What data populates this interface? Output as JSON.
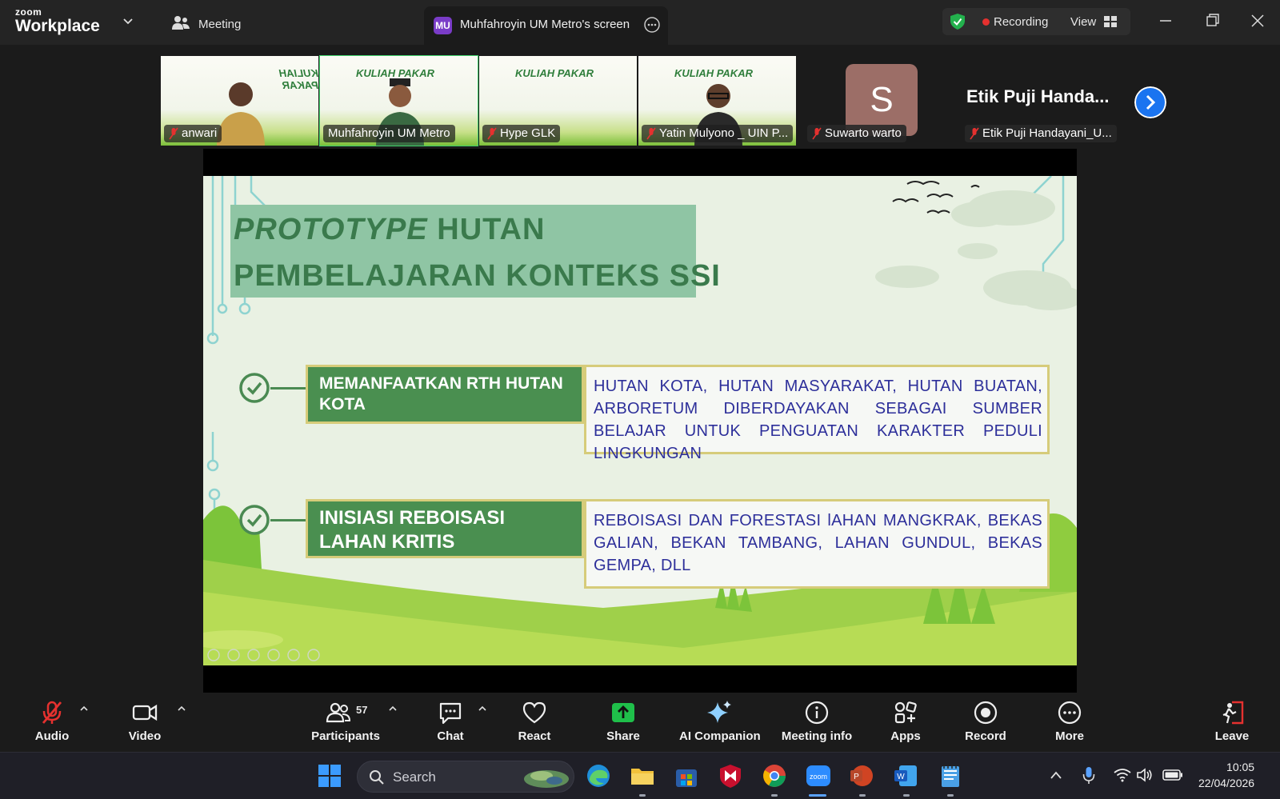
{
  "app": {
    "logo_line1": "zoom",
    "logo_line2": "Workplace",
    "meeting_label": "Meeting",
    "share_tab": {
      "badge": "MU",
      "label": "Muhfahroyin UM Metro's screen"
    },
    "recording_label": "Recording",
    "view_label": "View"
  },
  "participants": [
    {
      "name": "anwari",
      "muted": true
    },
    {
      "name": "Muhfahroyin UM Metro",
      "muted": false,
      "active": true
    },
    {
      "name": "Hype GLK",
      "muted": true
    },
    {
      "name": "Yatin Mulyono _ UIN P...",
      "muted": true
    },
    {
      "name": "Suwarto warto",
      "muted": true,
      "avatar": "S"
    },
    {
      "name": "Etik Puji Handayani_U...",
      "muted": true,
      "display": "Etik Puji Handa..."
    }
  ],
  "tile_banner_text": "KULIAH PAKAR",
  "slide": {
    "title_italic": "PROTOTYPE",
    "title_rest": " HUTAN",
    "title_line2": "PEMBELAJARAN KONTEKS SSI",
    "items": [
      {
        "label": "MEMANFAATKAN RTH HUTAN KOTA",
        "desc": "HUTAN KOTA, HUTAN MASYARAKAT, HUTAN BUATAN, ARBORETUM DIBERDAYAKAN SEBAGAI SUMBER BELAJAR UNTUK PENGUATAN KARAKTER PEDULI LINGKUNGAN"
      },
      {
        "label": "INISIASI REBOISASI LAHAN KRITIS",
        "desc": "REBOISASI DAN FORESTASI lAHAN MANGKRAK, BEKAS GALIAN, BEKAN TAMBANG, LAHAN GUNDUL, BEKAS GEMPA, DLL"
      }
    ]
  },
  "toolbar": {
    "audio": "Audio",
    "video": "Video",
    "participants": "Participants",
    "participant_count": "57",
    "chat": "Chat",
    "react": "React",
    "share": "Share",
    "ai_companion": "AI Companion",
    "meeting_info": "Meeting info",
    "apps": "Apps",
    "record": "Record",
    "more": "More",
    "leave": "Leave"
  },
  "colors": {
    "share_green": "#1fbf4a",
    "leave_red": "#e5312f",
    "next_blue": "#1a74f0",
    "slide_green": "#4a8f50",
    "desc_text": "#2d2f9a"
  },
  "taskbar": {
    "search_placeholder": "Search",
    "time": "10:05",
    "date": "22/04/2026"
  }
}
